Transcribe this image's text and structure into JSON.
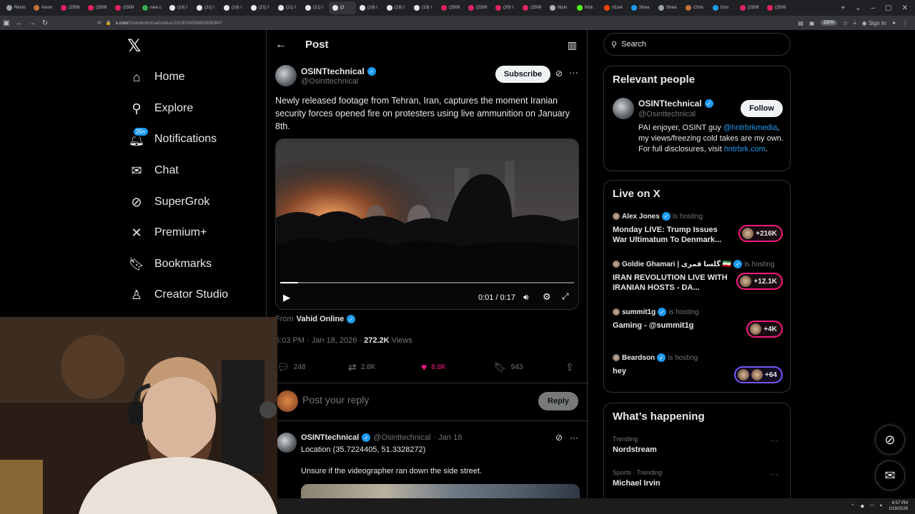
{
  "browser": {
    "tabs": [
      {
        "label": "Resto",
        "color": "#9aa0a6"
      },
      {
        "label": "Asmo",
        "color": "#c0703a"
      },
      {
        "label": "(2509",
        "color": "#e0245e"
      },
      {
        "label": "(2509",
        "color": "#e0245e"
      },
      {
        "label": "(2509",
        "color": "#e0245e"
      },
      {
        "label": "new c",
        "color": "#34a853"
      },
      {
        "label": "(19) I",
        "color": "#e7e9ea"
      },
      {
        "label": "(21) I",
        "color": "#e7e9ea"
      },
      {
        "label": "(19) I",
        "color": "#e7e9ea"
      },
      {
        "label": "(21) I",
        "color": "#e7e9ea"
      },
      {
        "label": "(21) I",
        "color": "#e7e9ea"
      },
      {
        "label": "(21) I",
        "color": "#e7e9ea"
      },
      {
        "label": "(2",
        "color": "#e7e9ea"
      },
      {
        "label": "(19) I",
        "color": "#e7e9ea"
      },
      {
        "label": "(19) I",
        "color": "#e7e9ea"
      },
      {
        "label": "(19) I",
        "color": "#e7e9ea"
      },
      {
        "label": "(2509",
        "color": "#e0245e"
      },
      {
        "label": "(2509",
        "color": "#e0245e"
      },
      {
        "label": "(20) I",
        "color": "#e0245e"
      },
      {
        "label": "(2509",
        "color": "#e0245e"
      },
      {
        "label": "Nicki",
        "color": "#b0b0b0"
      },
      {
        "label": "Kick",
        "color": "#53fc18"
      },
      {
        "label": "r/Live",
        "color": "#ff4500"
      },
      {
        "label": "Strea",
        "color": "#1d9bf0"
      },
      {
        "label": "Strea",
        "color": "#9aa0a6"
      },
      {
        "label": "Chris",
        "color": "#c0703a"
      },
      {
        "label": "Don",
        "color": "#1d9bf0"
      },
      {
        "label": "(2509",
        "color": "#e0245e"
      },
      {
        "label": "(2509",
        "color": "#e0245e"
      }
    ],
    "url_domain": "x.com",
    "url_path": "/Osinttechnical/status/2013024506609090847",
    "zoom": "150%",
    "signin": "Sign in"
  },
  "nav": {
    "items": [
      {
        "label": "Home",
        "icon": "home-icon"
      },
      {
        "label": "Explore",
        "icon": "search-icon"
      },
      {
        "label": "Notifications",
        "icon": "bell-icon"
      },
      {
        "label": "Chat",
        "icon": "mail-icon"
      },
      {
        "label": "SuperGrok",
        "icon": "grok-icon"
      },
      {
        "label": "Premium+",
        "icon": "x-icon"
      },
      {
        "label": "Bookmarks",
        "icon": "bookmark-icon"
      },
      {
        "label": "Creator Studio",
        "icon": "creator-icon"
      }
    ],
    "notifications_badge": "20+"
  },
  "post": {
    "header_title": "Post",
    "author_name": "OSINTtechnical",
    "author_handle": "@Osinttechnical",
    "subscribe_label": "Subscribe",
    "text": "Newly released footage from Tehran, Iran, captures the moment Iranian security forces opened fire on protesters using live ammunition on January 8th.",
    "video_time": "0:01 / 0:17",
    "video_progress": 0.06,
    "from_prefix": "From",
    "from_source": "Vahid Online",
    "meta_time": "6:03 PM · Jan 18, 2026 · ",
    "views_count": "272.2K",
    "views_label": " Views",
    "replies": "248",
    "reposts": "2.8K",
    "likes": "8.8K",
    "bookmarks": "943",
    "reply_placeholder": "Post your reply",
    "reply_button": "Reply"
  },
  "reply_post": {
    "author_name": "OSINTtechnical",
    "author_handle": "@Osinttechnical",
    "date": "· Jan 18",
    "line1": "Location (35.7224405, 51.3328272)",
    "line2": "Unsure if the videographer ran down the side street."
  },
  "sidebar": {
    "search_placeholder": "Search",
    "relevant": {
      "title": "Relevant people",
      "name": "OSINTtechnical",
      "handle": "@Osinttechnical",
      "follow_label": "Follow",
      "bio_1": "PAI enjoyer, OSINT guy ",
      "bio_link": "@hntrbrkmedia",
      "bio_2": ", my views/freezing cold takes are my own. For full disclosures, visit ",
      "bio_site": "hntrbrk.com",
      "bio_end": "."
    },
    "live": {
      "title": "Live on X",
      "hosting_label": "is hosting",
      "items": [
        {
          "host": "Alex Jones",
          "title": "Monday LIVE: Trump Issues War Ultimatum To Denmark...",
          "count": "+216K"
        },
        {
          "host": "Goldie Ghamari | گلسا قمری 🇮🇷",
          "title": "IRAN REVOLUTION LIVE WITH IRANIAN HOSTS - DA...",
          "count": "+12.1K"
        },
        {
          "host": "summit1g",
          "title": "Gaming - @summit1g",
          "count": "+4K"
        },
        {
          "host": "Beardson",
          "title": "hey",
          "count": "+64"
        }
      ]
    },
    "happening": {
      "title": "What’s happening",
      "trends": [
        {
          "category": "Trending",
          "name": "Nordstream"
        },
        {
          "category": "Sports · Trending",
          "name": "Michael Irvin"
        }
      ]
    }
  },
  "taskbar": {
    "time": "6:57 PM",
    "date": "1/19/2026"
  }
}
